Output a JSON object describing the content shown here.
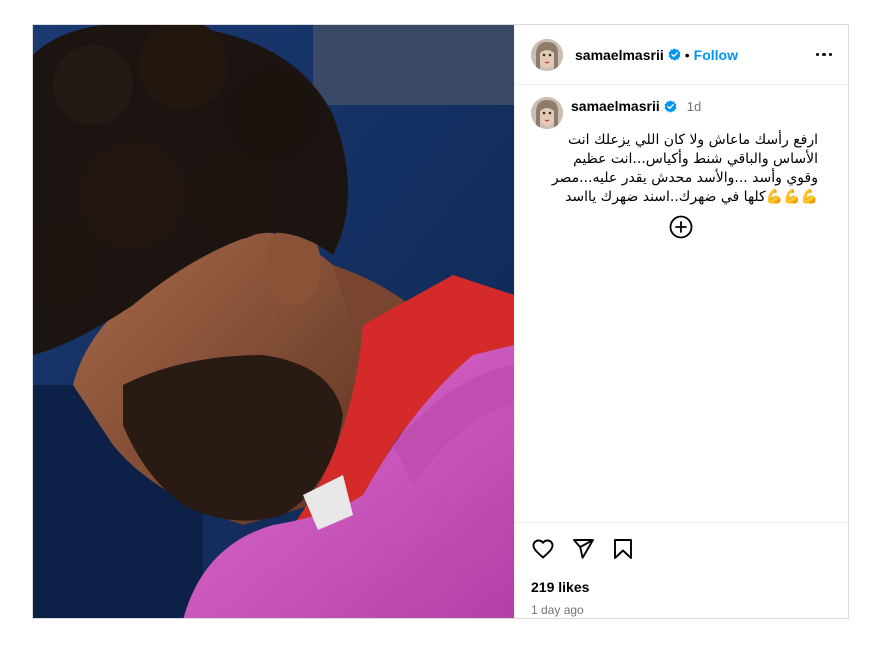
{
  "post": {
    "username": "samaelmasrii",
    "follow_label": "Follow",
    "separator": "•",
    "caption": {
      "time": "1d",
      "line1": "ارفع رأسك ماعاش ولا كان اللي يزعلك انت",
      "line2": "الأساس والباقي شنط وأكياس...انت عظيم",
      "line3": "وقوي وأسد ...والأسد محدش يقدر عليه...مصر",
      "line4": "كلها في ضهرك..اسند ضهرك يااسد",
      "emoji": "💪💪💪"
    },
    "likes": "219 likes",
    "posted": "1 day ago"
  },
  "colors": {
    "accent": "#0095f6",
    "muted": "#737373",
    "border": "#dbdbdb"
  },
  "icons": [
    "verified-badge-icon",
    "more-options-icon",
    "load-more-comments-icon",
    "heart-icon",
    "share-icon",
    "bookmark-icon"
  ]
}
